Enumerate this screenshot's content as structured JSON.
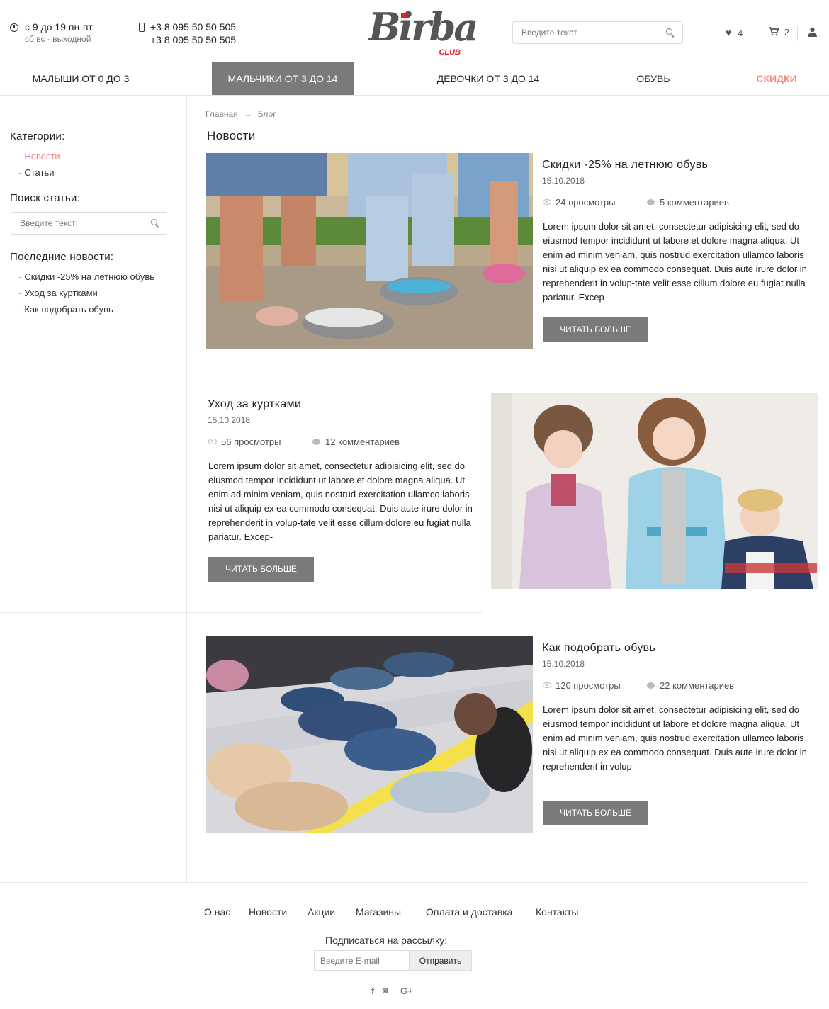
{
  "header": {
    "hours_line1": "с 9 до 19 пн-пт",
    "hours_line2": "сб вс - выходной",
    "phone1": "+3 8 095 50 50 505",
    "phone2": "+3 8 095 50 50 505",
    "logo_main": "Birba",
    "logo_sub": "CLUB",
    "search_placeholder": "Введите текст",
    "wishlist_count": "4",
    "cart_count": "2"
  },
  "nav": {
    "items": [
      {
        "label": "МАЛЫШИ ОТ 0 ДО 3"
      },
      {
        "label": "МАЛЬЧИКИ ОТ 3 ДО 14"
      },
      {
        "label": "ДЕВОЧКИ ОТ 3 ДО 14"
      },
      {
        "label": "ОБУВЬ"
      },
      {
        "label": "СКИДКИ"
      }
    ]
  },
  "sidebar": {
    "categories_title": "Категории:",
    "categories": [
      {
        "label": "Новости"
      },
      {
        "label": "Статьи"
      }
    ],
    "search_title": "Поиск статьи:",
    "search_placeholder": "Введите текст",
    "latest_title": "Последние новости:",
    "latest": [
      {
        "label": "Скидки -25% на летнюю обувь"
      },
      {
        "label": "Уход за куртками"
      },
      {
        "label": "Как подобрать обувь"
      }
    ]
  },
  "breadcrumbs": {
    "home": "Главная",
    "arrow": "→",
    "current": "Блог"
  },
  "page_title": "Новости",
  "posts": [
    {
      "title": "Скидки -25% на летнюю обувь",
      "date": "15.10.2018",
      "views": "24 просмотры",
      "comments": "5 комментариев",
      "text": "Lorem ipsum dolor sit amet, consectetur adipisicing elit, sed do eiusmod tempor incididunt ut labore et dolore magna aliqua. Ut enim ad minim veniam, quis nostrud exercitation ullamco laboris nisi ut aliquip ex ea commodo consequat. Duis aute irure dolor in reprehenderit in volup-tate velit esse cillum dolore eu fugiat nulla pariatur. Excep-",
      "button": "ЧИТАТЬ БОЛЬШЕ"
    },
    {
      "title": "Уход за куртками",
      "date": "15.10.2018",
      "views": "56 просмотры",
      "comments": "12 комментариев",
      "text": "Lorem ipsum dolor sit amet, consectetur adipisicing elit, sed do eiusmod tempor incididunt ut labore et dolore magna aliqua. Ut enim ad minim veniam, quis nostrud exercitation ullamco laboris nisi ut aliquip ex ea commodo consequat. Duis aute irure dolor in reprehenderit in volup-tate velit esse cillum dolore eu fugiat nulla pariatur. Excep-",
      "button": "ЧИТАТЬ БОЛЬШЕ"
    },
    {
      "title": "Как подобрать обувь",
      "date": "15.10.2018",
      "views": "120 просмотры",
      "comments": "22 комментариев",
      "text": "Lorem ipsum dolor sit amet, consectetur adipisicing elit, sed do eiusmod tempor incididunt ut labore et dolore magna aliqua. Ut enim ad minim veniam, quis nostrud exercitation ullamco laboris nisi ut aliquip ex ea commodo consequat. Duis aute irure dolor in reprehenderit in volup-",
      "button": "ЧИТАТЬ БОЛЬШЕ"
    }
  ],
  "footer": {
    "links": [
      {
        "label": "О нас"
      },
      {
        "label": "Новости"
      },
      {
        "label": "Акции"
      },
      {
        "label": "Магазины"
      },
      {
        "label": "Оплата и доставка"
      },
      {
        "label": "Контакты"
      }
    ],
    "subscribe_label": "Подписаться на рассылку:",
    "email_placeholder": "Введите E-mail",
    "send_label": "Отправить",
    "social": {
      "facebook": "f",
      "instagram": "◙",
      "google_plus": "G+"
    }
  },
  "colors": {
    "accent": "#f28b82",
    "button": "#7a7a7a",
    "logo_red": "#e41e26"
  }
}
